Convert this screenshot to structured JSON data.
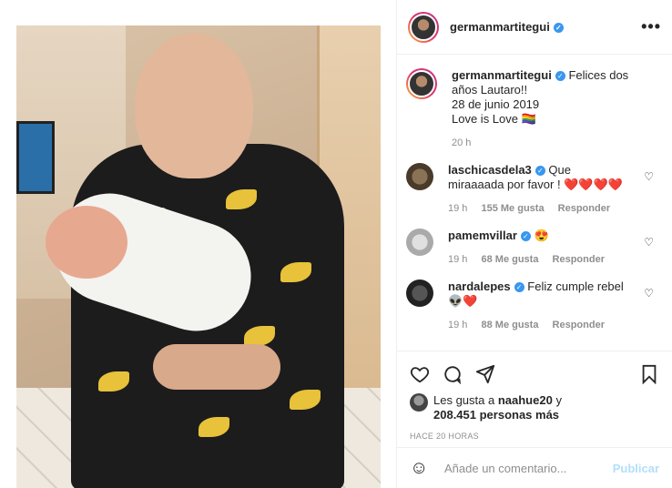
{
  "header": {
    "username": "germanmartitegui",
    "verified_mark": "✓",
    "more_icon": "•••"
  },
  "caption": {
    "username": "germanmartitegui",
    "line1": "Felices dos años Lautaro!!",
    "line2": "28 de junio 2019",
    "line3": "Love is Love 🏳️‍🌈",
    "time": "20 h"
  },
  "comments": [
    {
      "username": "laschicasdela3",
      "text": "Que miraaaada por favor ! ❤️❤️❤️❤️",
      "time": "19 h",
      "likes": "155 Me gusta",
      "reply": "Responder"
    },
    {
      "username": "pamemvillar",
      "text": "😍",
      "time": "19 h",
      "likes": "68 Me gusta",
      "reply": "Responder"
    },
    {
      "username": "nardalepes",
      "text": "Feliz cumple rebel 👽❤️",
      "time": "19 h",
      "likes": "88 Me gusta",
      "reply": "Responder"
    }
  ],
  "likes": {
    "prefix": "Les gusta a",
    "user": "naahue20",
    "suffix": "y",
    "count": "208.451 personas más"
  },
  "timestamp": "HACE 20 HORAS",
  "add_comment": {
    "placeholder": "Añade un comentario...",
    "post_label": "Publicar"
  },
  "colors": {
    "verified": "#3897f0",
    "post_disabled": "#b2dffc",
    "muted": "#8e8e8e"
  }
}
